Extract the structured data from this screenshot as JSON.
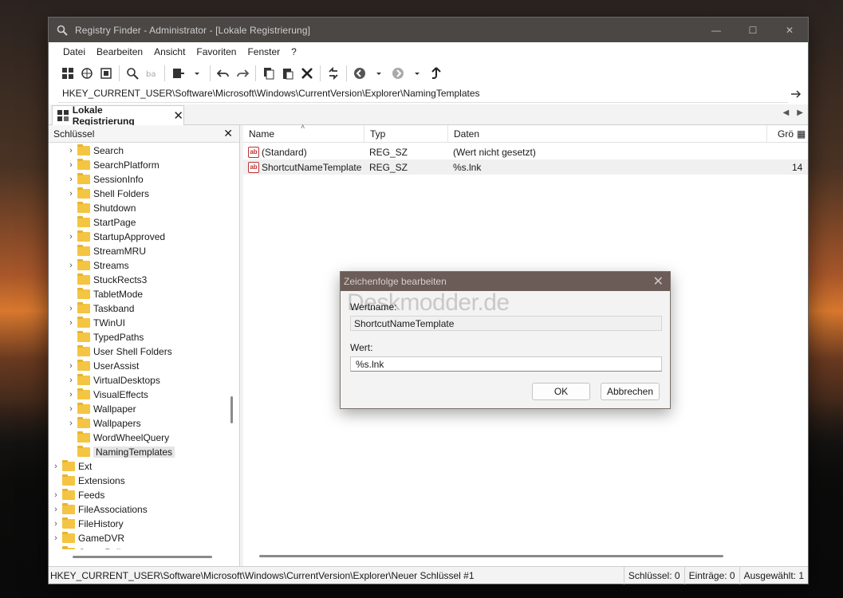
{
  "window": {
    "title": "Registry Finder - Administrator - [Lokale Registrierung]",
    "controls": [
      "—",
      "☐",
      "✕"
    ]
  },
  "menu": [
    "Datei",
    "Bearbeiten",
    "Ansicht",
    "Favoriten",
    "Fenster",
    "?"
  ],
  "address": {
    "path": "HKEY_CURRENT_USER\\Software\\Microsoft\\Windows\\CurrentVersion\\Explorer\\NamingTemplates"
  },
  "tabs": [
    {
      "label": "Lokale Registrierung"
    }
  ],
  "left_pane": {
    "header": "Schlüssel",
    "tree": [
      {
        "label": "Search",
        "has_children": true,
        "level": 2
      },
      {
        "label": "SearchPlatform",
        "has_children": true,
        "level": 2
      },
      {
        "label": "SessionInfo",
        "has_children": true,
        "level": 2
      },
      {
        "label": "Shell Folders",
        "has_children": true,
        "level": 2
      },
      {
        "label": "Shutdown",
        "has_children": false,
        "level": 2
      },
      {
        "label": "StartPage",
        "has_children": false,
        "level": 2
      },
      {
        "label": "StartupApproved",
        "has_children": true,
        "level": 2
      },
      {
        "label": "StreamMRU",
        "has_children": false,
        "level": 2
      },
      {
        "label": "Streams",
        "has_children": true,
        "level": 2
      },
      {
        "label": "StuckRects3",
        "has_children": false,
        "level": 2
      },
      {
        "label": "TabletMode",
        "has_children": false,
        "level": 2
      },
      {
        "label": "Taskband",
        "has_children": true,
        "level": 2
      },
      {
        "label": "TWinUI",
        "has_children": true,
        "level": 2
      },
      {
        "label": "TypedPaths",
        "has_children": false,
        "level": 2
      },
      {
        "label": "User Shell Folders",
        "has_children": false,
        "level": 2
      },
      {
        "label": "UserAssist",
        "has_children": true,
        "level": 2
      },
      {
        "label": "VirtualDesktops",
        "has_children": true,
        "level": 2
      },
      {
        "label": "VisualEffects",
        "has_children": true,
        "level": 2
      },
      {
        "label": "Wallpaper",
        "has_children": true,
        "level": 2
      },
      {
        "label": "Wallpapers",
        "has_children": true,
        "level": 2
      },
      {
        "label": "WordWheelQuery",
        "has_children": false,
        "level": 2
      },
      {
        "label": "NamingTemplates",
        "has_children": false,
        "level": 2,
        "selected": true
      },
      {
        "label": "Ext",
        "has_children": true,
        "level": 1
      },
      {
        "label": "Extensions",
        "has_children": false,
        "level": 1
      },
      {
        "label": "Feeds",
        "has_children": true,
        "level": 1
      },
      {
        "label": "FileAssociations",
        "has_children": true,
        "level": 1
      },
      {
        "label": "FileHistory",
        "has_children": true,
        "level": 1
      },
      {
        "label": "GameDVR",
        "has_children": true,
        "level": 1
      },
      {
        "label": "GroupPolicy",
        "has_children": true,
        "level": 1
      }
    ]
  },
  "right_pane": {
    "columns": [
      "Name",
      "Typ",
      "Daten",
      "Grö"
    ],
    "rows": [
      {
        "name": "(Standard)",
        "type": "REG_SZ",
        "data": "(Wert nicht gesetzt)",
        "size": ""
      },
      {
        "name": "ShortcutNameTemplate",
        "type": "REG_SZ",
        "data": "%s.lnk",
        "size": "14"
      }
    ]
  },
  "status": {
    "path": "HKEY_CURRENT_USER\\Software\\Microsoft\\Windows\\CurrentVersion\\Explorer\\Neuer Schlüssel #1",
    "keys": "Schlüssel: 0",
    "entries": "Einträge: 0",
    "selected": "Ausgewählt: 1"
  },
  "dialog": {
    "title": "Zeichenfolge bearbeiten",
    "watermark": "Deskmodder.de",
    "name_label": "Wertname:",
    "name_value": "ShortcutNameTemplate",
    "value_label": "Wert:",
    "value": "%s.lnk",
    "ok_label": "OK",
    "cancel_label": "Abbrechen"
  }
}
